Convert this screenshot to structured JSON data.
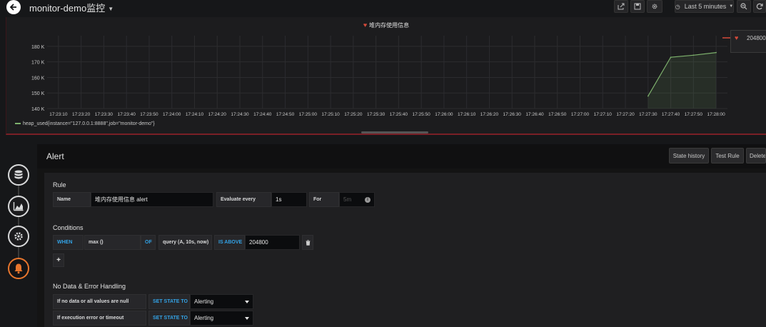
{
  "topbar": {
    "title": "monitor-demo监控",
    "time_range": "Last 5 minutes"
  },
  "panel": {
    "title": "堆内存使用信息",
    "threshold_value": "204800",
    "legend": "heap_used{instance=\"127.0.0.1:8888\",job=\"monitor-demo\"}",
    "colors": {
      "series": "#7eb26d",
      "alert_border": "#7a1f26",
      "heart": "#d44a3a"
    }
  },
  "chart_data": {
    "type": "line",
    "title": "堆内存使用信息",
    "xlabel": "",
    "ylabel": "",
    "x_ticks": [
      "17:23:10",
      "17:23:20",
      "17:23:30",
      "17:23:40",
      "17:23:50",
      "17:24:00",
      "17:24:10",
      "17:24:20",
      "17:24:30",
      "17:24:40",
      "17:24:50",
      "17:25:00",
      "17:25:10",
      "17:25:20",
      "17:25:30",
      "17:25:40",
      "17:25:50",
      "17:26:00",
      "17:26:10",
      "17:26:20",
      "17:26:30",
      "17:26:40",
      "17:26:50",
      "17:27:00",
      "17:27:10",
      "17:27:20",
      "17:27:30",
      "17:27:40",
      "17:27:50",
      "17:28:00"
    ],
    "y_ticks": [
      "140 K",
      "150 K",
      "160 K",
      "170 K",
      "180 K"
    ],
    "ylim": [
      140000,
      185000
    ],
    "xlim": [
      "17:23:05",
      "17:28:05"
    ],
    "grid": true,
    "legend_position": "bottom-left",
    "series": [
      {
        "name": "heap_used{instance=\"127.0.0.1:8888\",job=\"monitor-demo\"}",
        "x": [
          "17:27:30",
          "17:27:40",
          "17:27:50",
          "17:28:00"
        ],
        "y": [
          148000,
          173000,
          174300,
          176000
        ]
      }
    ]
  },
  "alert": {
    "title": "Alert",
    "buttons": {
      "state_history": "State history",
      "test_rule": "Test Rule",
      "delete": "Delete"
    },
    "rule": {
      "section": "Rule",
      "name_label": "Name",
      "name_value": "堆内存使用信息 alert",
      "evaluate_label": "Evaluate every",
      "evaluate_value": "1s",
      "for_label": "For",
      "for_placeholder": "5m"
    },
    "conditions": {
      "section": "Conditions",
      "when": "WHEN",
      "reducer": "max ()",
      "of": "OF",
      "query": "query (A, 10s, now)",
      "evaluator": "IS ABOVE",
      "threshold": "204800"
    },
    "no_data": {
      "section": "No Data & Error Handling",
      "rows": [
        {
          "label": "If no data or all values are null",
          "set_state": "SET STATE TO",
          "value": "Alerting"
        },
        {
          "label": "If execution error or timeout",
          "set_state": "SET STATE TO",
          "value": "Alerting"
        }
      ]
    }
  },
  "rail": {
    "icons": [
      "database-icon",
      "chart-area-icon",
      "gear-icon",
      "bell-icon"
    ]
  }
}
